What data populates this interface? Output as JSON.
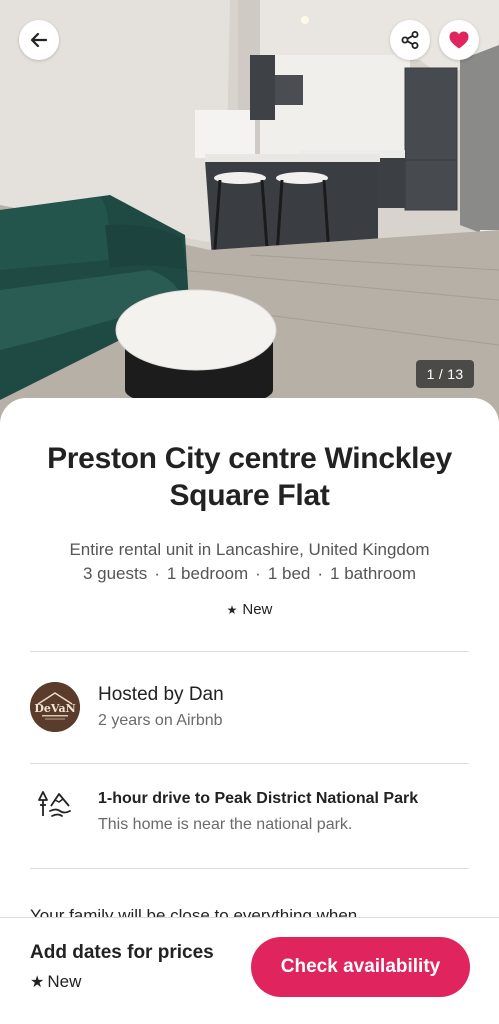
{
  "hero": {
    "photo_counter": "1 / 13",
    "icons": {
      "back": "arrow-left-icon",
      "share": "share-icon",
      "favorite": "heart-icon"
    },
    "favorite_active": true,
    "favorite_color": "#E0245E"
  },
  "listing": {
    "title": "Preston City centre Winckley Square Flat",
    "subtitle": "Entire rental unit in Lancashire, United Kingdom",
    "specs": [
      "3 guests",
      "1 bedroom",
      "1 bed",
      "1 bathroom"
    ],
    "rating_label": "New"
  },
  "host": {
    "name": "Hosted by Dan",
    "tenure": "2 years on Airbnb",
    "avatar_text": "DeVaN"
  },
  "highlight": {
    "icon": "national-park-icon",
    "title": "1-hour drive to Peak District National Park",
    "subtitle": "This home is near the national park."
  },
  "description_peek": "Your family will be close to everything when",
  "footer": {
    "price_label": "Add dates for prices",
    "rating_label": "New",
    "cta_label": "Check availability",
    "accent_color": "#E0245E"
  }
}
